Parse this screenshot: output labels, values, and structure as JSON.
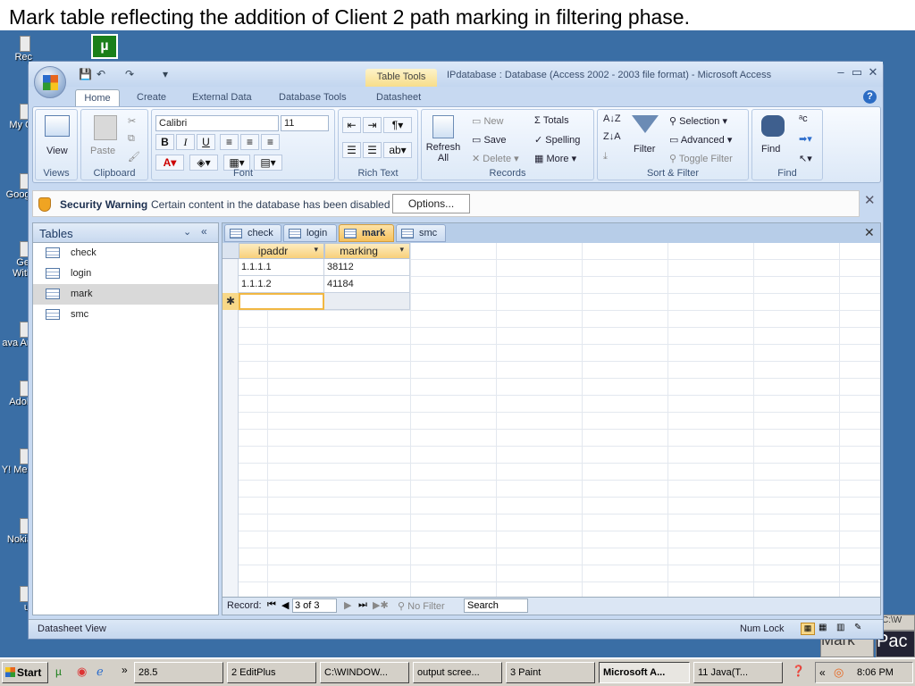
{
  "caption": "Mark table reflecting the addition of Client 2 path marking in filtering phase.",
  "desktop": {
    "icons": [
      "Rec",
      "My C",
      "Googl",
      "Get With",
      "ava An",
      "Adob",
      "Y! Mes",
      "Nokia",
      "ut"
    ],
    "utorrent_glyph": "µ"
  },
  "window": {
    "context_tab": "Table Tools",
    "title": "IPdatabase : Database (Access 2002 - 2003 file format) - Microsoft Access",
    "ribbon_tabs": [
      "Home",
      "Create",
      "External Data",
      "Database Tools",
      "Datasheet"
    ],
    "groups": {
      "views": "Views",
      "clipboard": "Clipboard",
      "font": "Font",
      "rich_text": "Rich Text",
      "records": "Records",
      "sort_filter": "Sort & Filter",
      "find": "Find"
    },
    "buttons": {
      "view": "View",
      "paste": "Paste",
      "font_name": "Calibri",
      "font_size": "11",
      "refresh": "Refresh All",
      "new": "New",
      "save": "Save",
      "delete": "Delete",
      "totals": "Totals",
      "spelling": "Spelling",
      "more": "More",
      "filter": "Filter",
      "selection": "Selection",
      "advanced": "Advanced",
      "toggle_filter": "Toggle Filter",
      "find": "Find",
      "bold": "B",
      "italic": "I",
      "underline": "U"
    },
    "security": {
      "title": "Security Warning",
      "text": "Certain content in the database has been disabled",
      "options": "Options..."
    },
    "nav": {
      "title": "Tables",
      "items": [
        "check",
        "login",
        "mark",
        "smc"
      ],
      "selected": "mark"
    },
    "doc_tabs": [
      "check",
      "login",
      "mark",
      "smc"
    ],
    "active_tab": "mark",
    "table": {
      "columns": [
        "ipaddr",
        "marking"
      ],
      "rows": [
        [
          "1.1.1.1",
          "38112"
        ],
        [
          "1.1.1.2",
          "41184"
        ]
      ],
      "new_row_marker": "✱"
    },
    "record_bar": {
      "label": "Record:",
      "position": "3 of 3",
      "filter": "No Filter",
      "search": "Search"
    },
    "status": {
      "left": "Datasheet View",
      "num_lock": "Num Lock"
    }
  },
  "taskbar": {
    "start": "Start",
    "items": [
      "28.5",
      "2 EditPlus",
      "C:\\WINDOW...",
      "output scree...",
      "3 Paint",
      "Microsoft A...",
      "11 Java(T..."
    ],
    "active": "Microsoft A...",
    "clock": "8:06 PM",
    "behind": [
      "C:\\W",
      "Mark",
      "Pac"
    ]
  }
}
